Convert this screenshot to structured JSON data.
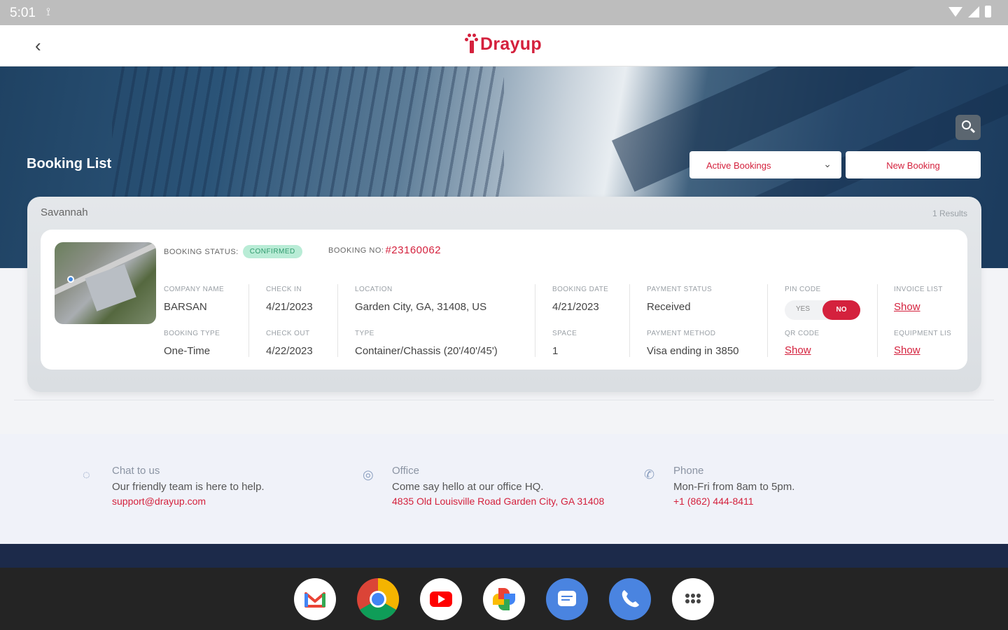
{
  "status_bar": {
    "time": "5:01",
    "usb_icon": "usb-icon"
  },
  "app": {
    "brand": "Drayup"
  },
  "hero": {
    "title": "Booking List",
    "filter_selected": "Active Bookings",
    "new_booking_label": "New Booking"
  },
  "results": {
    "group": "Savannah",
    "count": "1 Results"
  },
  "booking": {
    "status_label": "BOOKING STATUS:",
    "status_value": "CONFIRMED",
    "number_label": "BOOKING NO:",
    "number_value": "#23160062",
    "company_name_label": "COMPANY NAME",
    "company_name": "BARSAN",
    "booking_type_label": "BOOKING TYPE",
    "booking_type": "One-Time",
    "check_in_label": "CHECK IN",
    "check_in": "4/21/2023",
    "check_out_label": "CHECK OUT",
    "check_out": "4/22/2023",
    "location_label": "LOCATION",
    "location": "Garden City, GA, 31408, US",
    "type_label": "TYPE",
    "type": "Container/Chassis (20'/40'/45')",
    "booking_date_label": "BOOKING DATE",
    "booking_date": "4/21/2023",
    "space_label": "SPACE",
    "space": "1",
    "payment_status_label": "PAYMENT STATUS",
    "payment_status": "Received",
    "payment_method_label": "PAYMENT METHOD",
    "payment_method": "Visa ending in 3850",
    "pin_code_label": "PIN CODE",
    "pin_yes": "YES",
    "pin_no": "NO",
    "qr_code_label": "QR CODE",
    "qr_code_link": "Show",
    "invoice_list_label": "INVOICE LIST",
    "invoice_link": "Show",
    "equipment_label": "EQUIPMENT LIS",
    "equipment_link": "Show"
  },
  "contact": {
    "chat": {
      "title": "Chat to us",
      "desc": "Our friendly team is here to help.",
      "link": "support@drayup.com"
    },
    "office": {
      "title": "Office",
      "desc": "Come say hello at our office HQ.",
      "link": "4835 Old Louisville Road Garden City, GA 31408"
    },
    "phone": {
      "title": "Phone",
      "desc": "Mon-Fri from 8am to 5pm.",
      "link": "+1 (862) 444-8411"
    }
  },
  "dock_apps": [
    "gmail-icon",
    "chrome-icon",
    "youtube-icon",
    "photos-icon",
    "messages-icon",
    "phone-icon",
    "app-drawer-icon"
  ]
}
